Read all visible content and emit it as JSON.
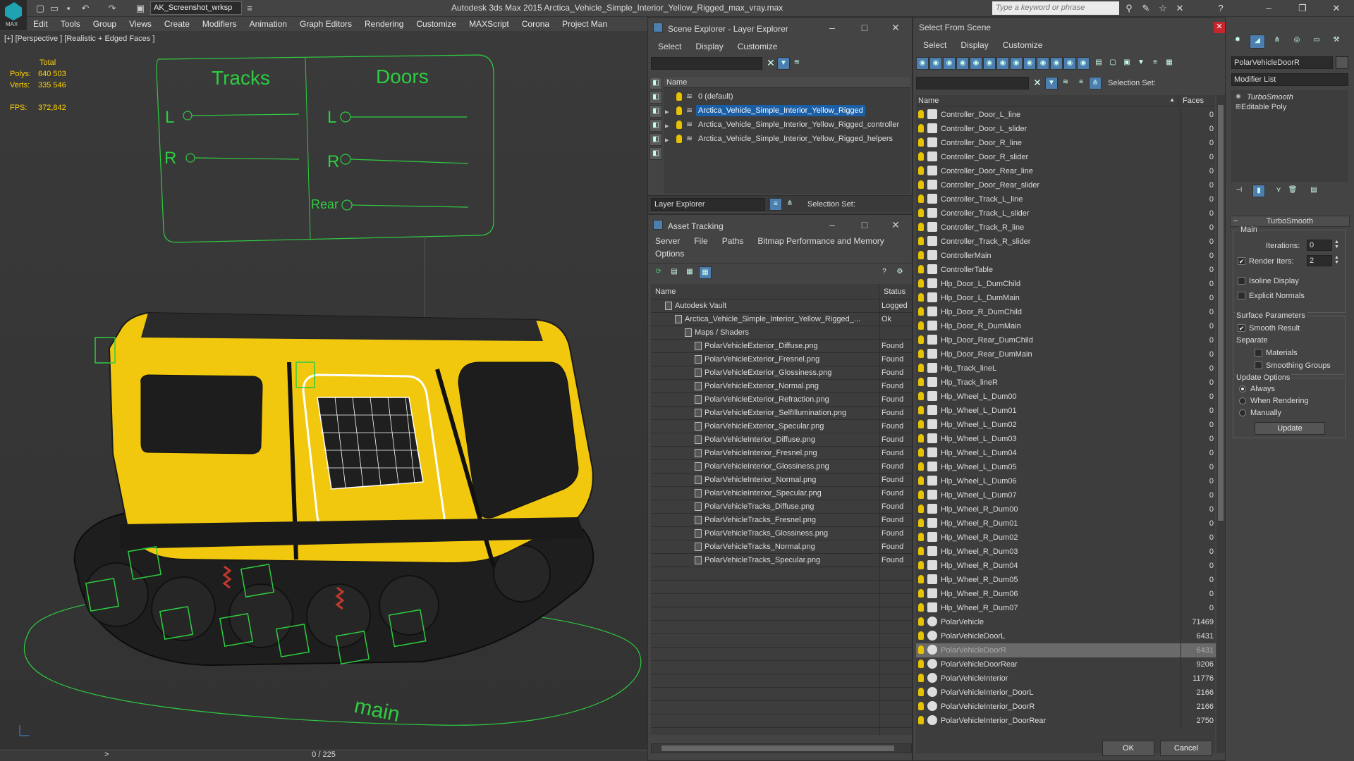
{
  "app": {
    "title": "Autodesk 3ds Max  2015    Arctica_Vehicle_Simple_Interior_Yellow_Rigged_max_vray.max",
    "workspace": "AK_Screenshot_wrksp",
    "logo_text": "MAX",
    "search_placeholder": "Type a keyword or phrase"
  },
  "menu": [
    "Edit",
    "Tools",
    "Group",
    "Views",
    "Create",
    "Modifiers",
    "Animation",
    "Graph Editors",
    "Rendering",
    "Customize",
    "MAXScript",
    "Corona",
    "Project Man"
  ],
  "viewport": {
    "label": "[+] [Perspective ] [Realistic + Edged Faces ]",
    "stats": {
      "header": "Total",
      "polys_label": "Polys:",
      "polys": "640 503",
      "verts_label": "Verts:",
      "verts": "335 546",
      "fps_label": "FPS:",
      "fps": "372,842"
    },
    "controller": {
      "tracks": "Tracks",
      "doors": "Doors",
      "l": "L",
      "r": "R",
      "rear": "Rear"
    },
    "ground_text": "main"
  },
  "timeline": {
    "frame": "0 / 225",
    "next": ">"
  },
  "scene_explorer": {
    "title": "Scene Explorer - Layer Explorer",
    "menu": [
      "Select",
      "Display",
      "Customize"
    ],
    "column": "Name",
    "layers": [
      {
        "name": "0 (default)",
        "expand": false,
        "selected": false
      },
      {
        "name": "Arctica_Vehicle_Simple_Interior_Yellow_Rigged",
        "expand": true,
        "selected": true
      },
      {
        "name": "Arctica_Vehicle_Simple_Interior_Yellow_Rigged_controller",
        "expand": true,
        "selected": false
      },
      {
        "name": "Arctica_Vehicle_Simple_Interior_Yellow_Rigged_helpers",
        "expand": true,
        "selected": false
      }
    ],
    "footer_mode": "Layer Explorer",
    "selection_set": "Selection Set:"
  },
  "asset_tracking": {
    "title": "Asset Tracking",
    "menu": [
      "Server",
      "File",
      "Paths",
      "Bitmap Performance and Memory"
    ],
    "menu2": "Options",
    "col_name": "Name",
    "col_status": "Status",
    "rows": [
      {
        "name": "Autodesk Vault",
        "status": "Logged",
        "indent": 20
      },
      {
        "name": "Arctica_Vehicle_Simple_Interior_Yellow_Rigged_...",
        "status": "Ok",
        "indent": 34
      },
      {
        "name": "Maps / Shaders",
        "status": "",
        "indent": 48
      },
      {
        "name": "PolarVehicleExterior_Diffuse.png",
        "status": "Found",
        "indent": 62
      },
      {
        "name": "PolarVehicleExterior_Fresnel.png",
        "status": "Found",
        "indent": 62
      },
      {
        "name": "PolarVehicleExterior_Glossiness.png",
        "status": "Found",
        "indent": 62
      },
      {
        "name": "PolarVehicleExterior_Normal.png",
        "status": "Found",
        "indent": 62
      },
      {
        "name": "PolarVehicleExterior_Refraction.png",
        "status": "Found",
        "indent": 62
      },
      {
        "name": "PolarVehicleExterior_SelfIllumination.png",
        "status": "Found",
        "indent": 62
      },
      {
        "name": "PolarVehicleExterior_Specular.png",
        "status": "Found",
        "indent": 62
      },
      {
        "name": "PolarVehicleInterior_Diffuse.png",
        "status": "Found",
        "indent": 62
      },
      {
        "name": "PolarVehicleInterior_Fresnel.png",
        "status": "Found",
        "indent": 62
      },
      {
        "name": "PolarVehicleInterior_Glossiness.png",
        "status": "Found",
        "indent": 62
      },
      {
        "name": "PolarVehicleInterior_Normal.png",
        "status": "Found",
        "indent": 62
      },
      {
        "name": "PolarVehicleInterior_Specular.png",
        "status": "Found",
        "indent": 62
      },
      {
        "name": "PolarVehicleTracks_Diffuse.png",
        "status": "Found",
        "indent": 62
      },
      {
        "name": "PolarVehicleTracks_Fresnel.png",
        "status": "Found",
        "indent": 62
      },
      {
        "name": "PolarVehicleTracks_Glossiness.png",
        "status": "Found",
        "indent": 62
      },
      {
        "name": "PolarVehicleTracks_Normal.png",
        "status": "Found",
        "indent": 62
      },
      {
        "name": "PolarVehicleTracks_Specular.png",
        "status": "Found",
        "indent": 62
      }
    ]
  },
  "select_from_scene": {
    "title": "Select From Scene",
    "menu": [
      "Select",
      "Display",
      "Customize"
    ],
    "selection_set": "Selection Set:",
    "col_name": "Name",
    "col_faces": "Faces",
    "ok": "OK",
    "cancel": "Cancel",
    "rows": [
      {
        "name": "Controller_Door_L_line",
        "faces": "0"
      },
      {
        "name": "Controller_Door_L_slider",
        "faces": "0"
      },
      {
        "name": "Controller_Door_R_line",
        "faces": "0"
      },
      {
        "name": "Controller_Door_R_slider",
        "faces": "0"
      },
      {
        "name": "Controller_Door_Rear_line",
        "faces": "0"
      },
      {
        "name": "Controller_Door_Rear_slider",
        "faces": "0"
      },
      {
        "name": "Controller_Track_L_line",
        "faces": "0"
      },
      {
        "name": "Controller_Track_L_slider",
        "faces": "0"
      },
      {
        "name": "Controller_Track_R_line",
        "faces": "0"
      },
      {
        "name": "Controller_Track_R_slider",
        "faces": "0"
      },
      {
        "name": "ControllerMain",
        "faces": "0"
      },
      {
        "name": "ControllerTable",
        "faces": "0"
      },
      {
        "name": "Hlp_Door_L_DumChild",
        "faces": "0"
      },
      {
        "name": "Hlp_Door_L_DumMain",
        "faces": "0"
      },
      {
        "name": "Hlp_Door_R_DumChild",
        "faces": "0"
      },
      {
        "name": "Hlp_Door_R_DumMain",
        "faces": "0"
      },
      {
        "name": "Hlp_Door_Rear_DumChild",
        "faces": "0"
      },
      {
        "name": "Hlp_Door_Rear_DumMain",
        "faces": "0"
      },
      {
        "name": "Hlp_Track_lineL",
        "faces": "0"
      },
      {
        "name": "Hlp_Track_lineR",
        "faces": "0"
      },
      {
        "name": "Hlp_Wheel_L_Dum00",
        "faces": "0"
      },
      {
        "name": "Hlp_Wheel_L_Dum01",
        "faces": "0"
      },
      {
        "name": "Hlp_Wheel_L_Dum02",
        "faces": "0"
      },
      {
        "name": "Hlp_Wheel_L_Dum03",
        "faces": "0"
      },
      {
        "name": "Hlp_Wheel_L_Dum04",
        "faces": "0"
      },
      {
        "name": "Hlp_Wheel_L_Dum05",
        "faces": "0"
      },
      {
        "name": "Hlp_Wheel_L_Dum06",
        "faces": "0"
      },
      {
        "name": "Hlp_Wheel_L_Dum07",
        "faces": "0"
      },
      {
        "name": "Hlp_Wheel_R_Dum00",
        "faces": "0"
      },
      {
        "name": "Hlp_Wheel_R_Dum01",
        "faces": "0"
      },
      {
        "name": "Hlp_Wheel_R_Dum02",
        "faces": "0"
      },
      {
        "name": "Hlp_Wheel_R_Dum03",
        "faces": "0"
      },
      {
        "name": "Hlp_Wheel_R_Dum04",
        "faces": "0"
      },
      {
        "name": "Hlp_Wheel_R_Dum05",
        "faces": "0"
      },
      {
        "name": "Hlp_Wheel_R_Dum06",
        "faces": "0"
      },
      {
        "name": "Hlp_Wheel_R_Dum07",
        "faces": "0"
      },
      {
        "name": "PolarVehicle",
        "faces": "71469"
      },
      {
        "name": "PolarVehicleDoorL",
        "faces": "6431"
      },
      {
        "name": "PolarVehicleDoorR",
        "faces": "6431",
        "selected": true
      },
      {
        "name": "PolarVehicleDoorRear",
        "faces": "9206"
      },
      {
        "name": "PolarVehicleInterior",
        "faces": "11776"
      },
      {
        "name": "PolarVehicleInterior_DoorL",
        "faces": "2166"
      },
      {
        "name": "PolarVehicleInterior_DoorR",
        "faces": "2166"
      },
      {
        "name": "PolarVehicleInterior_DoorRear",
        "faces": "2750"
      }
    ]
  },
  "command_panel": {
    "object_name": "PolarVehicleDoorR",
    "modifier_list": "Modifier List",
    "stack": [
      "TurboSmooth",
      "Editable Poly"
    ],
    "rollout": "TurboSmooth",
    "main": "Main",
    "iterations_label": "Iterations:",
    "iterations": "0",
    "render_iters_label": "Render Iters:",
    "render_iters": "2",
    "isoline": "Isoline Display",
    "explicit": "Explicit Normals",
    "surface": "Surface Parameters",
    "smooth_result": "Smooth Result",
    "separate": "Separate",
    "materials": "Materials",
    "smoothing_groups": "Smoothing Groups",
    "update_options": "Update Options",
    "always": "Always",
    "when_rendering": "When Rendering",
    "manually": "Manually",
    "update": "Update"
  },
  "colors": {
    "accent": "#1a5ea6",
    "wire": "#2ecc40",
    "yellow": "#f2c80f"
  }
}
